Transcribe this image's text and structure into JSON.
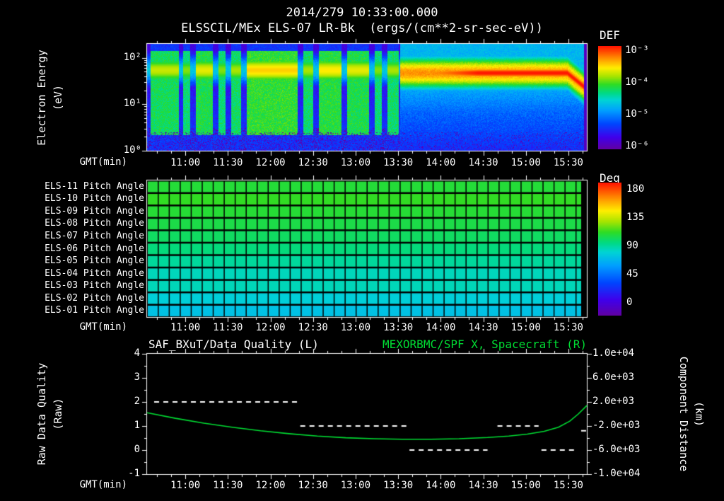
{
  "colors": {
    "background": "#000000",
    "text": "#ffffff",
    "accent_green": "#00dd33"
  },
  "header": {
    "datetime": "2014/279 10:33:00.000",
    "title": "ELSSCIL/MEx ELS-07 LR-Bk  (ergs/(cm**2-sr-sec-eV))",
    "def_label": "DEF",
    "deg_label": "Deg"
  },
  "axes": {
    "gmt_label": "GMT(min)",
    "time_ticks": [
      "11:00",
      "11:30",
      "12:00",
      "12:30",
      "13:00",
      "13:30",
      "14:00",
      "14:30",
      "15:00",
      "15:30"
    ],
    "first_tick_min": 27,
    "tick_step_min": 30,
    "t_max_min": 310
  },
  "spectrogram_axis": {
    "ylabel1": "Electron Energy",
    "ylabel2": "(eV)",
    "ytick_labels": [
      "10²",
      "10¹",
      "10⁰"
    ],
    "ytick_logvals": [
      2,
      1,
      0
    ],
    "log_top": 2.3,
    "colorbar_ticks": [
      "10⁻³",
      "10⁻⁴",
      "10⁻⁵",
      "10⁻⁶"
    ]
  },
  "pitch_axis": {
    "colorbar_ticks": [
      "180",
      "135",
      "90",
      "45",
      "0"
    ],
    "colorbar_tick_values": [
      180,
      135,
      90,
      45,
      0
    ]
  },
  "quality_axis": {
    "ylabel1": "Raw Data Quality",
    "ylabel2": "(Raw)",
    "right_label1": "Component Distance",
    "right_label2": "(km)"
  },
  "chart_data": [
    {
      "type": "heatmap",
      "title": "ELSSCIL/MEx ELS-07 LR-Bk",
      "units": "ergs/(cm**2-sr-sec-eV)",
      "colorbar_label": "DEF",
      "x_start_gmt": "10:33",
      "x_end_gmt": "15:43",
      "x_ticks": [
        "11:00",
        "11:30",
        "12:00",
        "12:30",
        "13:00",
        "13:30",
        "14:00",
        "14:30",
        "15:00",
        "15:30"
      ],
      "y_label": "Electron Energy (eV)",
      "y_scale": "log",
      "y_ticks_ev": [
        1,
        10,
        100
      ],
      "y_range_ev": [
        1,
        200
      ],
      "color_scale_range": [
        "1e-6",
        "1e-3"
      ],
      "main_band": {
        "center_ev": 50,
        "intense_after_gmt": "13:30",
        "drops_to_ev": 20,
        "at_end_gmt": "15:40"
      },
      "bright_intervals_min": [
        [
          2,
          22,
          0.7
        ],
        [
          25,
          30,
          0.5
        ],
        [
          34,
          46,
          0.8
        ],
        [
          50,
          55,
          0.5
        ],
        [
          59,
          66,
          0.6
        ],
        [
          70,
          106,
          1.0
        ],
        [
          110,
          117,
          0.6
        ],
        [
          121,
          137,
          0.9
        ],
        [
          141,
          156,
          0.8
        ],
        [
          160,
          165,
          0.5
        ],
        [
          169,
          177,
          0.6
        ]
      ],
      "continuous_after_min": 178
    },
    {
      "type": "heatmap",
      "title": "ELS Pitch Angles",
      "colorbar_label": "Deg",
      "color_range_deg": [
        0,
        180
      ],
      "rows": [
        {
          "label": "ELS-11 Pitch Angle",
          "mean_deg": 113
        },
        {
          "label": "ELS-10 Pitch Angle",
          "mean_deg": 111
        },
        {
          "label": "ELS-09 Pitch Angle",
          "mean_deg": 109
        },
        {
          "label": "ELS-08 Pitch Angle",
          "mean_deg": 107
        },
        {
          "label": "ELS-07 Pitch Angle",
          "mean_deg": 104
        },
        {
          "label": "ELS-06 Pitch Angle",
          "mean_deg": 101
        },
        {
          "label": "ELS-05 Pitch Angle",
          "mean_deg": 97
        },
        {
          "label": "ELS-04 Pitch Angle",
          "mean_deg": 93
        },
        {
          "label": "ELS-03 Pitch Angle",
          "mean_deg": 88
        },
        {
          "label": "ELS-02 Pitch Angle",
          "mean_deg": 83
        },
        {
          "label": "ELS-01 Pitch Angle",
          "mean_deg": 79
        }
      ]
    },
    {
      "type": "line",
      "left_title": "SAF_BXuT/Data Quality (L)",
      "right_title": "MEXORBMC/SPF X, Spacecraft (R)",
      "left_axis": {
        "label": "Raw Data Quality (Raw)",
        "ticks": [
          4,
          3,
          2,
          1,
          0,
          -1
        ],
        "range": [
          -1,
          4
        ]
      },
      "right_axis": {
        "label": "Component Distance (km)",
        "ticks": [
          "1.0e+04",
          "6.0e+03",
          "2.0e+03",
          "-2.0e+03",
          "-6.0e+03",
          "-1.0e+04"
        ],
        "range": [
          -10000,
          10000
        ]
      },
      "quality_segments": [
        {
          "t0_min": 5,
          "t1_min": 106,
          "value": 2
        },
        {
          "t0_min": 108,
          "t1_min": 184,
          "value": 1
        },
        {
          "t0_min": 185,
          "t1_min": 240,
          "value": 0
        },
        {
          "t0_min": 247,
          "t1_min": 276,
          "value": 1
        },
        {
          "t0_min": 278,
          "t1_min": 301,
          "value": 0
        },
        {
          "t0_min": 306,
          "t1_min": 310,
          "value": 0.8
        }
      ],
      "spacecraft_x": {
        "t_min": [
          0,
          20,
          40,
          60,
          80,
          100,
          120,
          140,
          160,
          180,
          200,
          220,
          240,
          255,
          268,
          280,
          290,
          298,
          304,
          310
        ],
        "km": [
          200,
          -720,
          -1520,
          -2200,
          -2800,
          -3280,
          -3680,
          -3960,
          -4120,
          -4200,
          -4200,
          -4120,
          -3920,
          -3680,
          -3360,
          -2880,
          -2200,
          -1200,
          0,
          1400
        ]
      }
    }
  ]
}
